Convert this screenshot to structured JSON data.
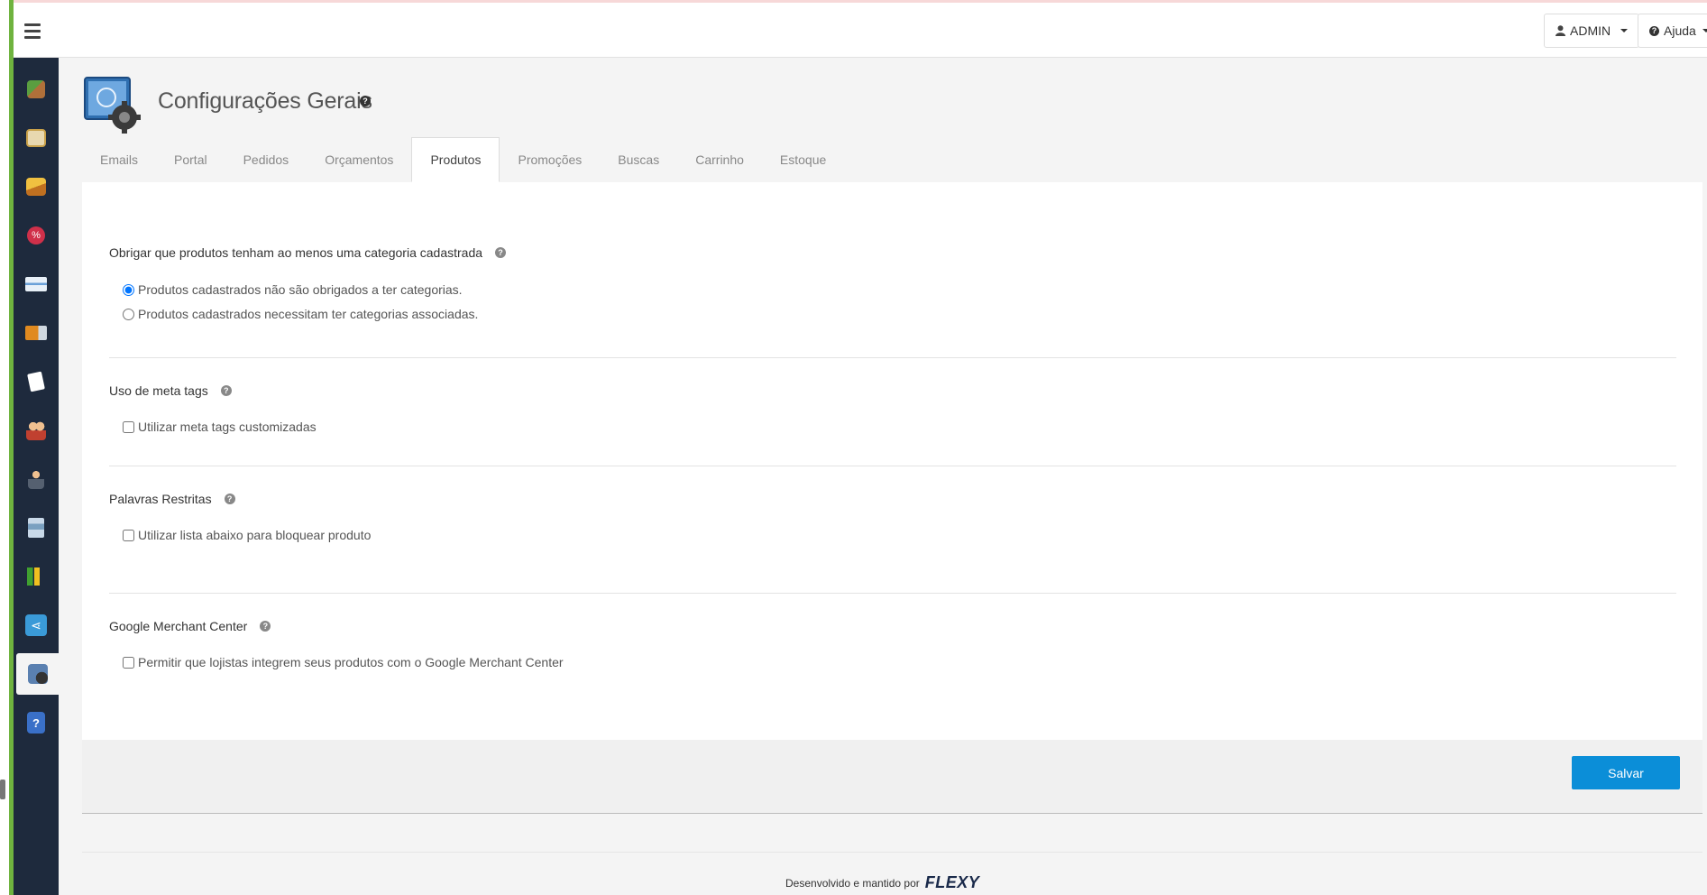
{
  "header": {
    "user_label": "ADMIN",
    "help_label": "Ajuda"
  },
  "sidebar": {
    "items": [
      {
        "icon": "box-icon",
        "color": "#8a6d3b"
      },
      {
        "icon": "catalog-icon",
        "color": "#c9a14a"
      },
      {
        "icon": "package-icon",
        "color": "#e0a020"
      },
      {
        "icon": "discount-icon",
        "color": "#d0304a"
      },
      {
        "icon": "card-icon",
        "color": "#6aa0d8"
      },
      {
        "icon": "truck-icon",
        "color": "#e08a20"
      },
      {
        "icon": "note-icon",
        "color": "#ffffff"
      },
      {
        "icon": "users-icon",
        "color": "#c04030"
      },
      {
        "icon": "person-icon",
        "color": "#b07050"
      },
      {
        "icon": "server-icon",
        "color": "#7aa0c0"
      },
      {
        "icon": "chart-icon",
        "color": "#40a030"
      },
      {
        "icon": "share-icon",
        "color": "#3a9ad8"
      },
      {
        "icon": "settings-icon",
        "color": "#5a80b0"
      },
      {
        "icon": "help-book-icon",
        "color": "#3a70c8"
      }
    ]
  },
  "page": {
    "title": "Configurações Gerais"
  },
  "tabs": [
    "Emails",
    "Portal",
    "Pedidos",
    "Orçamentos",
    "Produtos",
    "Promoções",
    "Buscas",
    "Carrinho",
    "Estoque"
  ],
  "sections": {
    "category": {
      "title": "Obrigar que produtos tenham ao menos uma categoria cadastrada",
      "option1": "Produtos cadastrados não são obrigados a ter categorias.",
      "option2": "Produtos cadastrados necessitam ter categorias associadas."
    },
    "meta": {
      "title": "Uso de meta tags",
      "option": "Utilizar meta tags customizadas"
    },
    "restricted": {
      "title": "Palavras Restritas",
      "option": "Utilizar lista abaixo para bloquear produto"
    },
    "merchant": {
      "title": "Google Merchant Center",
      "option": "Permitir que lojistas integrem seus produtos com o Google Merchant Center"
    }
  },
  "actions": {
    "save_label": "Salvar"
  },
  "footer": {
    "credit": "Desenvolvido e mantido por",
    "brand": "FLEXY"
  },
  "colors": {
    "accent": "#0b8ed8",
    "sidebar": "#1e2a3d",
    "green_bar": "#6fb33f"
  }
}
